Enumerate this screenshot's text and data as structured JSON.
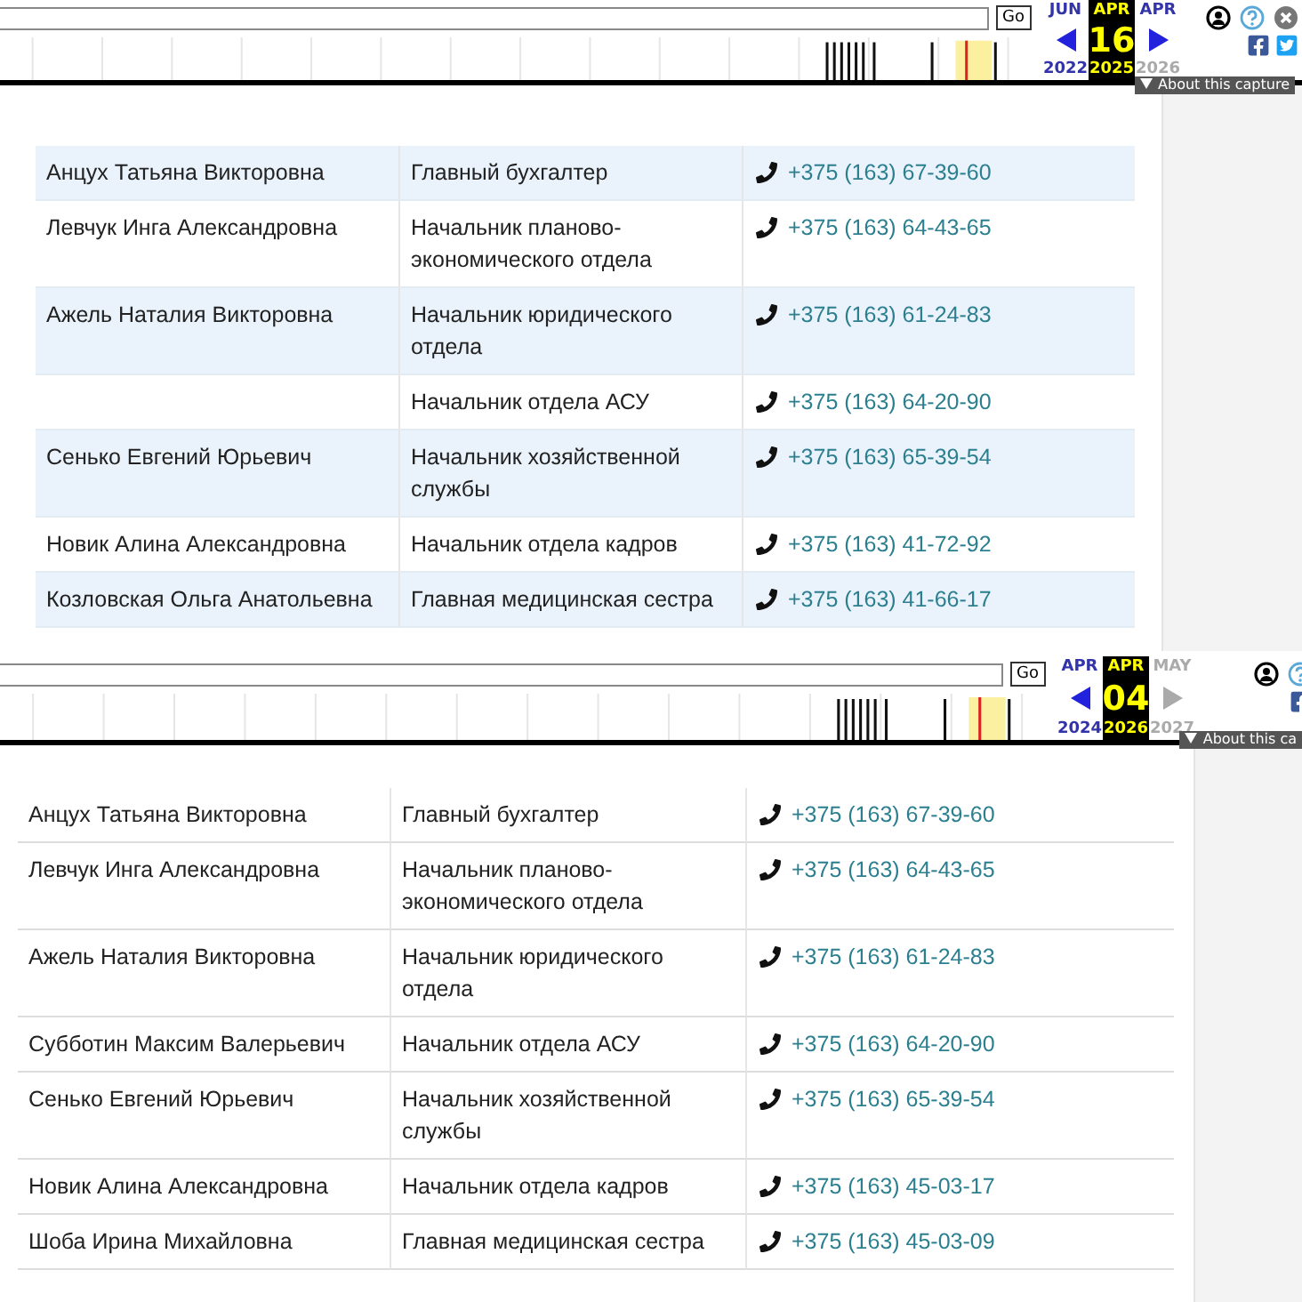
{
  "panels": [
    {
      "toolbar": {
        "go": "Go",
        "prev": {
          "month": "JUN",
          "year": "2022"
        },
        "current": {
          "month": "APR",
          "day": "16",
          "year": "2025"
        },
        "next": {
          "month": "APR",
          "year": "2026",
          "disabled": false
        },
        "about": "About this capture"
      },
      "rows": [
        {
          "name": "Анцух Татьяна Викторовна",
          "position": "Главный бухгалтер",
          "phone": "+375 (163) 67-39-60"
        },
        {
          "name": "Левчук Инга Александровна",
          "position": "Начальник планово-экономического отдела",
          "phone": "+375 (163) 64-43-65"
        },
        {
          "name": "Ажель Наталия Викторовна",
          "position": "Начальник юридического отдела",
          "phone": "+375 (163) 61-24-83"
        },
        {
          "position": "Начальник отдела АСУ",
          "phone": "+375 (163) 64-20-90"
        },
        {
          "name": "Сенько Евгений Юрьевич",
          "position": "Начальник хозяйственной службы",
          "phone": "+375 (163) 65-39-54"
        },
        {
          "name": "Новик Алина Александровна",
          "position": "Начальник отдела кадров",
          "phone": "+375 (163) 41-72-92"
        },
        {
          "name": "Козловская Ольга Анатольевна",
          "position": "Главная медицинская сестра",
          "phone": "+375 (163) 41-66-17"
        }
      ]
    },
    {
      "toolbar": {
        "go": "Go",
        "prev": {
          "month": "APR",
          "year": "2024"
        },
        "current": {
          "month": "APR",
          "day": "04",
          "year": "2026"
        },
        "next": {
          "month": "MAY",
          "year": "2027",
          "disabled": true
        },
        "about": "About this ca"
      },
      "rows": [
        {
          "name": "Анцух Татьяна Викторовна",
          "position": "Главный бухгалтер",
          "phone": "+375 (163) 67-39-60"
        },
        {
          "name": "Левчук Инга Александровна",
          "position": "Начальник планово-экономического отдела",
          "phone": "+375 (163) 64-43-65"
        },
        {
          "name": "Ажель Наталия Викторовна",
          "position": "Начальник юридического отдела",
          "phone": "+375 (163) 61-24-83"
        },
        {
          "name": "Субботин Максим Валерьевич",
          "position": "Начальник отдела АСУ",
          "phone": "+375 (163) 64-20-90"
        },
        {
          "name": "Сенько Евгений Юрьевич",
          "position": "Начальник хозяйственной службы",
          "phone": "+375 (163) 65-39-54"
        },
        {
          "name": "Новик Алина Александровна",
          "position": "Начальник отдела кадров",
          "phone": "+375 (163) 45-03-17"
        },
        {
          "name": "Шоба Ирина Михайловна",
          "position": "Главная медицинская сестра",
          "phone": "+375 (163) 45-03-09"
        }
      ]
    }
  ]
}
